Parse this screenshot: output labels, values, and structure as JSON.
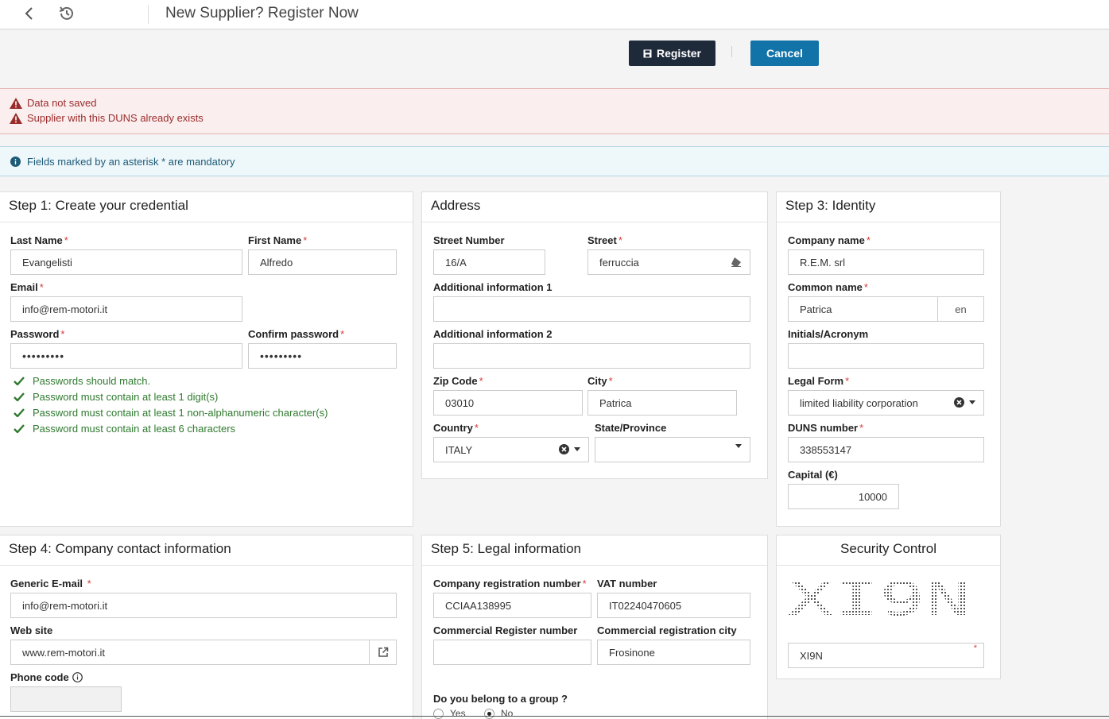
{
  "header": {
    "title": "New Supplier? Register Now"
  },
  "toolbar": {
    "register_label": "Register",
    "cancel_label": "Cancel"
  },
  "errors": [
    "Data not saved",
    "Supplier with this DUNS already exists"
  ],
  "info": "Fields marked by an asterisk * are mandatory",
  "step1": {
    "title": "Step 1: Create your credential",
    "last_name": {
      "label": "Last Name",
      "value": "Evangelisti"
    },
    "first_name": {
      "label": "First Name",
      "value": "Alfredo"
    },
    "email": {
      "label": "Email",
      "value": "info@rem-motori.it"
    },
    "password": {
      "label": "Password",
      "value": "•••••••••"
    },
    "confirm_password": {
      "label": "Confirm password",
      "value": "•••••••••"
    },
    "rules": [
      "Passwords should match.",
      "Password must contain at least 1 digit(s)",
      "Password must contain at least 1 non-alphanumeric character(s)",
      "Password must contain at least 6 characters"
    ]
  },
  "address": {
    "title": "Address",
    "street_number": {
      "label": "Street Number",
      "value": "16/A"
    },
    "street": {
      "label": "Street",
      "value": "ferruccia"
    },
    "additional1": {
      "label": "Additional information 1",
      "value": ""
    },
    "additional2": {
      "label": "Additional information 2",
      "value": ""
    },
    "zip": {
      "label": "Zip Code",
      "value": "03010"
    },
    "city": {
      "label": "City",
      "value": "Patrica"
    },
    "country": {
      "label": "Country",
      "value": "ITALY"
    },
    "state": {
      "label": "State/Province",
      "value": ""
    }
  },
  "step3": {
    "title": "Step 3: Identity",
    "company_name": {
      "label": "Company name",
      "value": "R.E.M. srl"
    },
    "common_name": {
      "label": "Common name",
      "value": "Patrica",
      "lang": "en"
    },
    "initials": {
      "label": "Initials/Acronym",
      "value": ""
    },
    "legal_form": {
      "label": "Legal Form",
      "value": "limited liability corporation"
    },
    "duns": {
      "label": "DUNS number",
      "value": "338553147"
    },
    "capital": {
      "label": "Capital (€)",
      "value": "10000"
    }
  },
  "step4": {
    "title": "Step 4: Company contact information",
    "generic_email": {
      "label": "Generic E-mail",
      "value": "info@rem-motori.it"
    },
    "website": {
      "label": "Web site",
      "value": "www.rem-motori.it"
    },
    "phone_code": {
      "label": "Phone code",
      "value": ""
    }
  },
  "step5": {
    "title": "Step 5: Legal information",
    "company_reg": {
      "label": "Company registration number",
      "value": "CCIAA138995"
    },
    "vat": {
      "label": "VAT number",
      "value": "IT02240470605"
    },
    "commercial_reg": {
      "label": "Commercial Register number",
      "value": ""
    },
    "commercial_city": {
      "label": "Commercial registration city",
      "value": "Frosinone"
    },
    "group_question": "Do you belong to a group ?",
    "group_yes": "Yes",
    "group_no": "No"
  },
  "security": {
    "title": "Security Control",
    "captcha_text": "XI9N",
    "value": "XI9N"
  },
  "colors": {
    "primary": "#1273a8",
    "dark": "#1e2a3a",
    "error": "#9b2c2c",
    "success": "#2f7a2f"
  }
}
